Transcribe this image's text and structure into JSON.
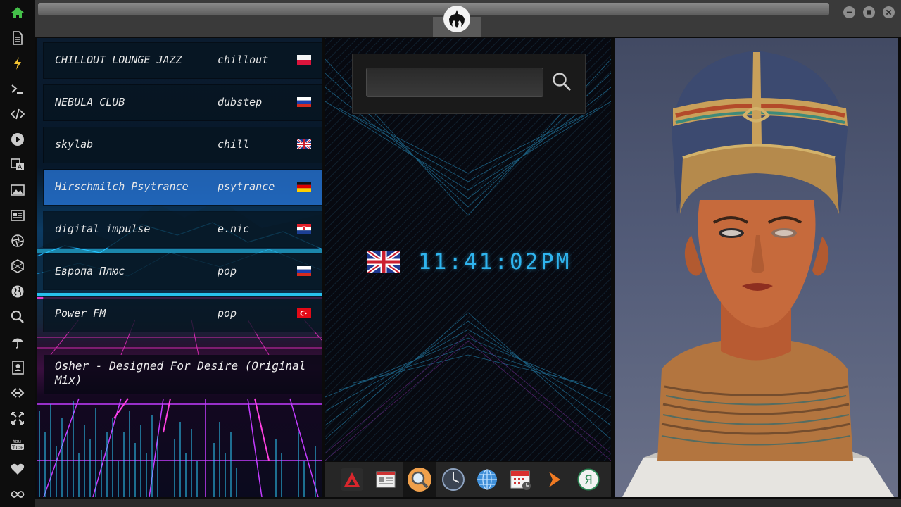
{
  "sidebar": {
    "items": [
      {
        "icon": "home-icon",
        "color": "#45c14a"
      },
      {
        "icon": "document-icon"
      },
      {
        "icon": "lightning-icon"
      },
      {
        "icon": "terminal-icon"
      },
      {
        "icon": "code-icon"
      },
      {
        "icon": "play-icon"
      },
      {
        "icon": "translate-icon"
      },
      {
        "icon": "image-icon"
      },
      {
        "icon": "news-icon"
      },
      {
        "icon": "aperture-icon"
      },
      {
        "icon": "hexagon-icon"
      },
      {
        "icon": "globe-icon"
      },
      {
        "icon": "search-icon"
      },
      {
        "icon": "umbrella-icon"
      },
      {
        "icon": "contacts-icon"
      },
      {
        "icon": "link-icon"
      },
      {
        "icon": "fullscreen-icon"
      },
      {
        "icon": "youtube-icon",
        "label": "You Tube"
      },
      {
        "icon": "heart-icon"
      },
      {
        "icon": "infinity-icon"
      }
    ]
  },
  "window": {
    "logo_icon": "rebel-alliance-icon",
    "controls": [
      "minimize-icon",
      "maximize-icon",
      "close-icon"
    ]
  },
  "stations": [
    {
      "name": "CHILLOUT LOUNGE JAZZ",
      "genre": "chillout",
      "flag": "poland"
    },
    {
      "name": "NEBULA CLUB",
      "genre": "dubstep",
      "flag": "russia"
    },
    {
      "name": "skylab",
      "genre": "chill",
      "flag": "uk"
    },
    {
      "name": "Hirschmilch Psytrance",
      "genre": "psytrance",
      "flag": "germany",
      "selected": true
    },
    {
      "name": "digital impulse",
      "genre": "e.nic",
      "flag": "croatia"
    },
    {
      "name": "Европа Плюс",
      "genre": "pop",
      "flag": "russia"
    },
    {
      "name": "Power FM",
      "genre": "pop",
      "flag": "turkey"
    }
  ],
  "now_playing": "Osher - Designed For Desire (Original Mix)",
  "search": {
    "value": "",
    "placeholder": ""
  },
  "clock": {
    "time": "11:41:02",
    "ampm": "PM",
    "flag": "uk",
    "color": "#2fb4ee"
  },
  "dock": {
    "items": [
      {
        "icon": "artix-icon"
      },
      {
        "icon": "news-reader-icon"
      },
      {
        "icon": "search-app-icon",
        "active": true
      },
      {
        "icon": "clock-app-icon"
      },
      {
        "icon": "web-browser-icon"
      },
      {
        "icon": "calendar-icon"
      },
      {
        "icon": "arrow-app-icon"
      },
      {
        "icon": "yandex-icon",
        "label": "Я"
      }
    ]
  },
  "image": {
    "subject": "nefertiti-bust"
  },
  "colors": {
    "selected_row": "#2878dc",
    "accent": "#2fb4ee"
  }
}
